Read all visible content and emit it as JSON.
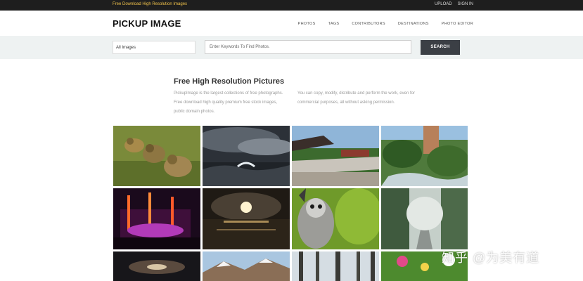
{
  "topbar": {
    "tagline": "Free Download High Resolution Images",
    "links": [
      "UPLOAD",
      "SIGN IN"
    ]
  },
  "header": {
    "logo": "PICKUP IMAGE",
    "nav": [
      "PHOTOS",
      "TAGS",
      "CONTRIBUTORS",
      "DESTINATIONS",
      "PHOTO EDITOR"
    ]
  },
  "search": {
    "category": "All Images",
    "placeholder": "Enter Keywords To Find Photos.",
    "button": "SEARCH"
  },
  "intro": {
    "title": "Free High Resolution Pictures",
    "left_text": "PickupImage is the largest collections of free photographs. Free download high quality premium free stock images, public domain photos.",
    "right_text": "You can copy, modify, distribute and perform the work, even for commercial purposes, all without asking permission."
  },
  "gallery": {
    "photos": [
      "goslings-photo",
      "stormy-sea-photo",
      "temple-wall-photo",
      "forest-waterfall-photo",
      "concert-stage-photo",
      "sunset-sea-photo",
      "lemur-photo",
      "foggy-road-photo",
      "galaxy-photo",
      "snowy-mountain-photo",
      "winter-forest-photo",
      "flowers-photo"
    ]
  },
  "watermark": "知乎 @为美有道"
}
